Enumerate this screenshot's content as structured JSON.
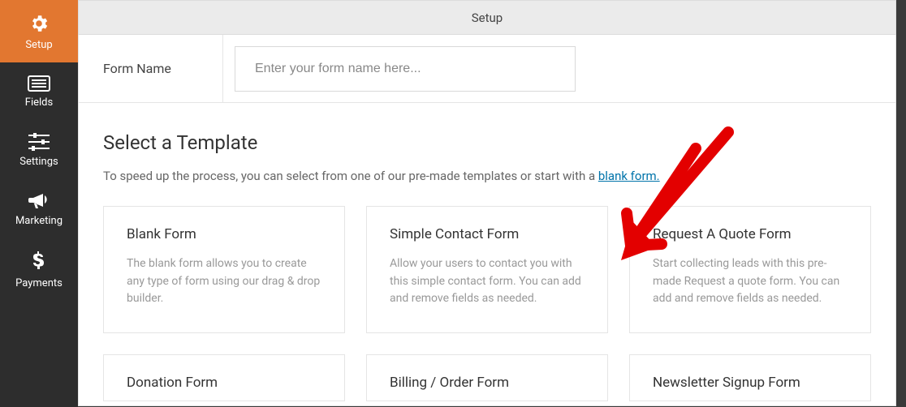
{
  "header": {
    "title": "Setup"
  },
  "sidebar": {
    "items": [
      {
        "label": "Setup"
      },
      {
        "label": "Fields"
      },
      {
        "label": "Settings"
      },
      {
        "label": "Marketing"
      },
      {
        "label": "Payments"
      }
    ]
  },
  "form_name": {
    "label": "Form Name",
    "placeholder": "Enter your form name here...",
    "value": ""
  },
  "template_section": {
    "title": "Select a Template",
    "desc_prefix": "To speed up the process, you can select from one of our pre-made templates or start with a ",
    "link_text": "blank form."
  },
  "templates": [
    {
      "title": "Blank Form",
      "desc": "The blank form allows you to create any type of form using our drag & drop builder."
    },
    {
      "title": "Simple Contact Form",
      "desc": "Allow your users to contact you with this simple contact form. You can add and remove fields as needed."
    },
    {
      "title": "Request A Quote Form",
      "desc": "Start collecting leads with this pre-made Request a quote form. You can add and remove fields as needed."
    },
    {
      "title": "Donation Form",
      "desc": ""
    },
    {
      "title": "Billing / Order Form",
      "desc": ""
    },
    {
      "title": "Newsletter Signup Form",
      "desc": ""
    }
  ]
}
